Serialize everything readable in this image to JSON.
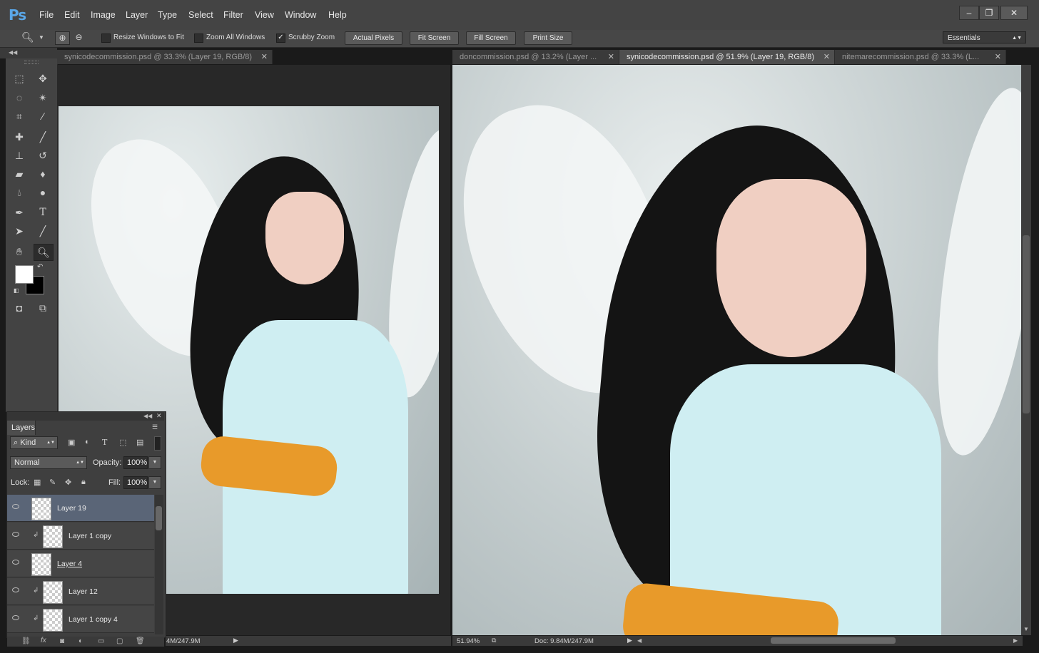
{
  "app": {
    "logo": "Ps"
  },
  "menu": [
    "File",
    "Edit",
    "Image",
    "Layer",
    "Type",
    "Select",
    "Filter",
    "View",
    "Window",
    "Help"
  ],
  "window_controls": [
    "–",
    "❐",
    "✕"
  ],
  "options": {
    "checks": [
      {
        "label": "Resize Windows to Fit",
        "checked": false
      },
      {
        "label": "Zoom All Windows",
        "checked": false
      },
      {
        "label": "Scrubby Zoom",
        "checked": true
      }
    ],
    "buttons": [
      "Actual Pixels",
      "Fit Screen",
      "Fill Screen",
      "Print Size"
    ],
    "workspace": "Essentials"
  },
  "tabs_left": [
    {
      "title": "synicodecommission.psd @ 33.3% (Layer 19, RGB/8)",
      "active": false
    }
  ],
  "tabs_right": [
    {
      "title": "doncommission.psd @ 13.2% (Layer ...",
      "active": false
    },
    {
      "title": "synicodecommission.psd @ 51.9% (Layer 19, RGB/8)",
      "active": true
    },
    {
      "title": "nitemarecommission.psd @ 33.3% (L...",
      "active": false
    }
  ],
  "layers_panel": {
    "title": "Layers",
    "filter": "Kind",
    "blend_mode": "Normal",
    "opacity_label": "Opacity:",
    "opacity": "100%",
    "lock_label": "Lock:",
    "fill_label": "Fill:",
    "fill": "100%",
    "layers": [
      {
        "name": "Layer 19",
        "selected": true,
        "clipped": false
      },
      {
        "name": "Layer 1 copy",
        "selected": false,
        "clipped": true
      },
      {
        "name": "Layer 4",
        "selected": false,
        "clipped": false
      },
      {
        "name": "Layer 12",
        "selected": false,
        "clipped": true
      },
      {
        "name": "Layer 1 copy 4",
        "selected": false,
        "clipped": true
      }
    ]
  },
  "status_left": "4M/247.9M",
  "status_right": {
    "zoom": "51.94%",
    "doc": "Doc: 9.84M/247.9M"
  }
}
